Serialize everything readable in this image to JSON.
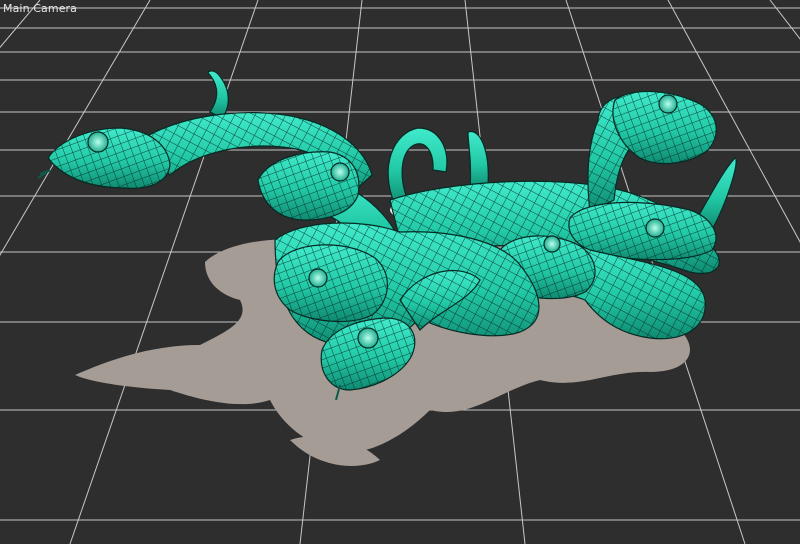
{
  "viewport": {
    "label": "Main Camera"
  },
  "scene": {
    "object": "snake-mass-3d-model",
    "render_mode": "wireframe-on-shaded",
    "colors": {
      "background": "#2e2e2e",
      "grid": "#d8d8d8",
      "mesh_fill": "#22c9a6",
      "mesh_fill_light": "#3fe8c8",
      "mesh_fill_dark": "#0f8a71",
      "wireframe": "#062a24",
      "shadow": "#a69c96",
      "underside": "#e8e8e8"
    }
  }
}
